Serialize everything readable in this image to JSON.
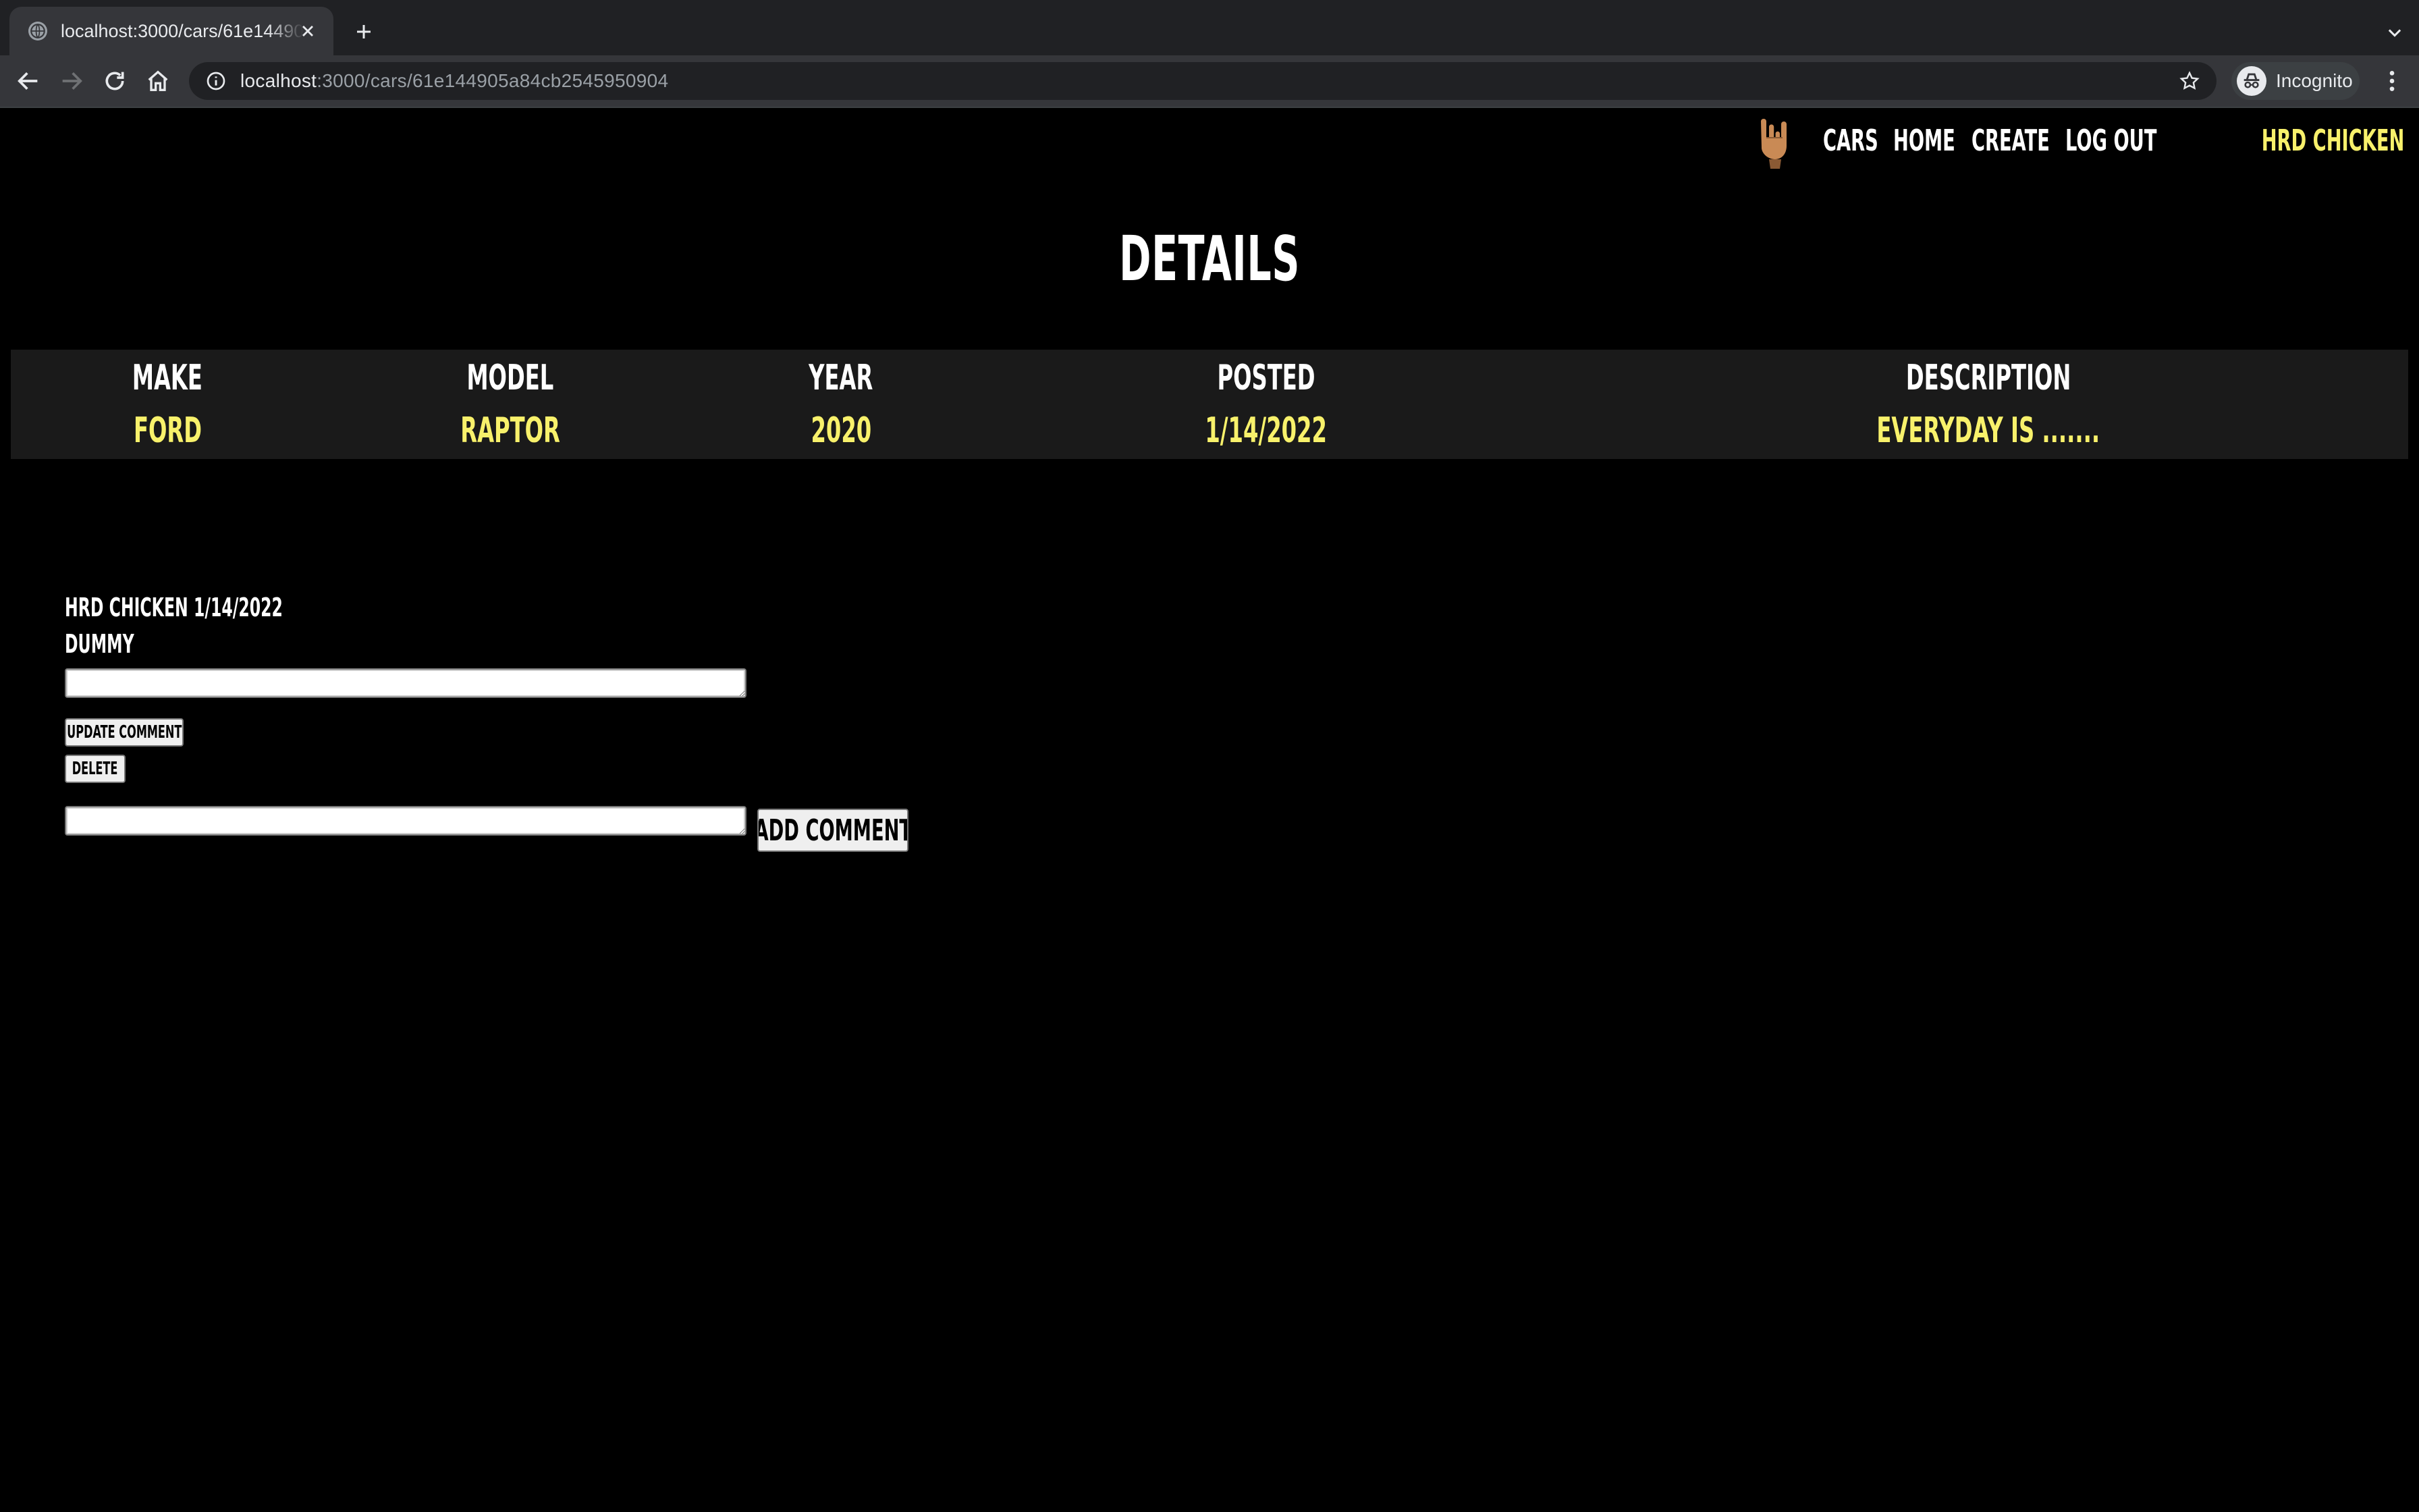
{
  "browser": {
    "tab_title": "localhost:3000/cars/61e144905a84cb2545950904",
    "url_host": "localhost",
    "url_path": ":3000/cars/61e144905a84cb2545950904",
    "profile_label": "Incognito"
  },
  "nav": {
    "links": [
      "CARS",
      "HOME",
      "CREATE",
      "LOG OUT"
    ],
    "user": "HRD CHICKEN"
  },
  "page": {
    "title": "DETAILS"
  },
  "details": {
    "headers": [
      "MAKE",
      "MODEL",
      "YEAR",
      "POSTED",
      "DESCRIPTION"
    ],
    "values": [
      "FORD",
      "RAPTOR",
      "2020",
      "1/14/2022",
      "EVERYDAY IS ......."
    ]
  },
  "comments": [
    {
      "meta": "HRD CHICKEN 1/14/2022",
      "body": "DUMMY",
      "edit_value": "",
      "update_label": "UPDATE COMMENT",
      "delete_label": "DELETE"
    }
  ],
  "new_comment": {
    "value": "",
    "button_label": "ADD COMMENT"
  },
  "colors": {
    "page_bg": "#000000",
    "table_bg": "#1a1a1a",
    "accent_yellow": "#f8f16b",
    "chrome_dark": "#202124",
    "chrome_toolbar": "#35363a"
  },
  "icons": [
    "globe-icon",
    "close-icon",
    "plus-icon",
    "chevron-down-icon",
    "back-icon",
    "forward-icon",
    "reload-icon",
    "home-icon",
    "info-icon",
    "star-icon",
    "incognito-icon",
    "kebab-menu-icon",
    "rock-hand-icon"
  ]
}
